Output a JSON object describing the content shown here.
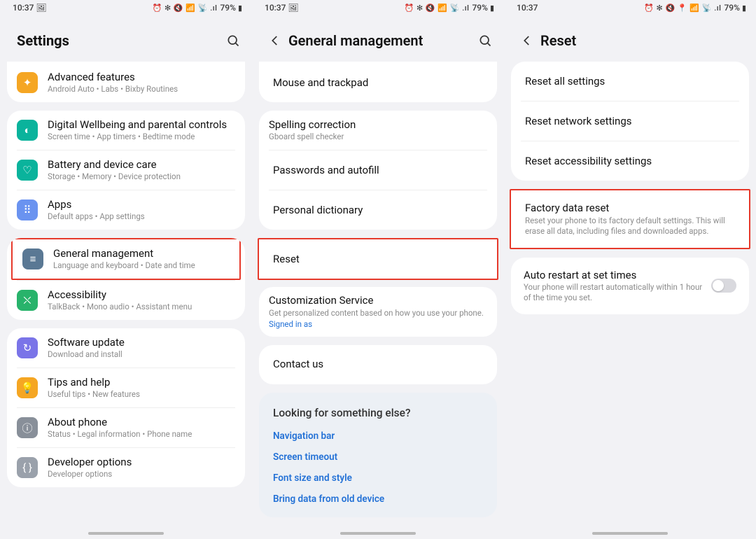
{
  "status": {
    "time": "10:37",
    "icons": "⏰ ✻ 🔇 📶 📡 .ıl",
    "battery": "79%"
  },
  "pane1": {
    "title": "Settings",
    "groups": [
      {
        "items": [
          {
            "icon": "advanced-icon",
            "color": "bg-orange",
            "title": "Advanced features",
            "sub": "Android Auto  •  Labs  •  Bixby Routines"
          }
        ],
        "partialTop": true
      },
      {
        "items": [
          {
            "icon": "wellbeing-icon",
            "color": "bg-teal",
            "title": "Digital Wellbeing and parental controls",
            "sub": "Screen time  •  App timers  •  Bedtime mode"
          },
          {
            "icon": "battery-icon",
            "color": "bg-teal2",
            "title": "Battery and device care",
            "sub": "Storage  •  Memory  •  Device protection"
          },
          {
            "icon": "apps-icon",
            "color": "bg-blue2",
            "title": "Apps",
            "sub": "Default apps  •  App settings"
          }
        ]
      },
      {
        "items": [
          {
            "icon": "general-icon",
            "color": "bg-steel",
            "title": "General management",
            "sub": "Language and keyboard  •  Date and time",
            "highlight": true
          },
          {
            "icon": "accessibility-icon",
            "color": "bg-green",
            "title": "Accessibility",
            "sub": "TalkBack  •  Mono audio  •  Assistant menu"
          }
        ]
      },
      {
        "items": [
          {
            "icon": "update-icon",
            "color": "bg-purple",
            "title": "Software update",
            "sub": "Download and install"
          },
          {
            "icon": "tips-icon",
            "color": "bg-amber",
            "title": "Tips and help",
            "sub": "Useful tips  •  New features"
          },
          {
            "icon": "about-icon",
            "color": "bg-gray",
            "title": "About phone",
            "sub": "Status  •  Legal information  •  Phone name"
          },
          {
            "icon": "developer-icon",
            "color": "bg-gray2",
            "title": "Developer options",
            "sub": "Developer options"
          }
        ]
      }
    ]
  },
  "pane2": {
    "title": "General management",
    "card1": [
      {
        "title": "Mouse and trackpad"
      }
    ],
    "card2": [
      {
        "title": "Spelling correction",
        "sub": "Gboard spell checker"
      },
      {
        "title": "Passwords and autofill"
      },
      {
        "title": "Personal dictionary"
      }
    ],
    "resetCard": [
      {
        "title": "Reset",
        "highlight": true
      },
      {
        "title": "Customization Service",
        "sub": "Get personalized content based on how you use your phone.",
        "link": "Signed in as"
      }
    ],
    "card4": [
      {
        "title": "Contact us"
      }
    ],
    "infocard": {
      "heading": "Looking for something else?",
      "links": [
        "Navigation bar",
        "Screen timeout",
        "Font size and style",
        "Bring data from old device"
      ]
    }
  },
  "pane3": {
    "title": "Reset",
    "card1": [
      {
        "title": "Reset all settings"
      },
      {
        "title": "Reset network settings"
      },
      {
        "title": "Reset accessibility settings"
      }
    ],
    "factoryCard": {
      "title": "Factory data reset",
      "sub": "Reset your phone to its factory default settings. This will erase all data, including files and downloaded apps."
    },
    "autoCard": {
      "title": "Auto restart at set times",
      "sub": "Your phone will restart automatically within 1 hour of the time you set."
    }
  }
}
